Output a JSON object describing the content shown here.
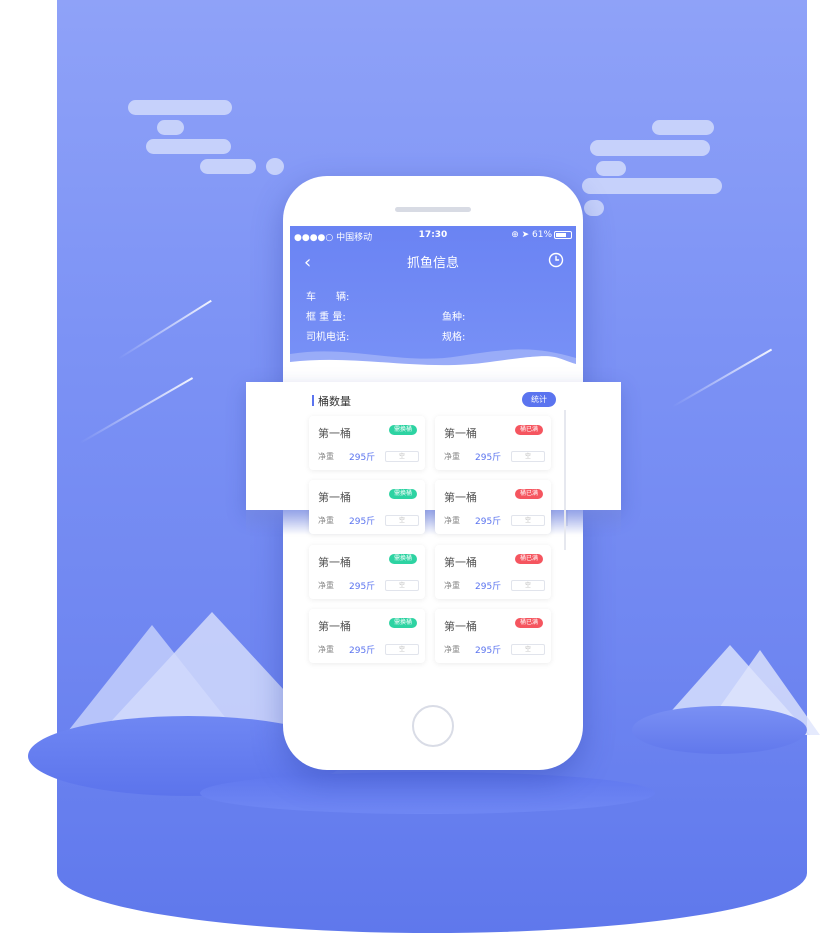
{
  "status_bar": {
    "carrier": "●●●●○ 中国移动",
    "time": "17:30",
    "battery": "⊕ ➤ 61%"
  },
  "nav": {
    "back_icon": "chevron-left-icon",
    "title": "抓鱼信息",
    "clock_icon": "clock-icon"
  },
  "info": {
    "vehicle_label": "车　　辆:",
    "frame_weight_label": "框 重 量:",
    "fish_type_label": "鱼种:",
    "driver_phone_label": "司机电话:",
    "spec_label": "规格:"
  },
  "section": {
    "title": "桶数量",
    "stat_button": "统计"
  },
  "buckets": [
    {
      "title": "第一桶",
      "badge": "需换桶",
      "badge_color": "#2dd3a2",
      "weight_label": "净重",
      "weight": "295斤",
      "input": "空"
    },
    {
      "title": "第一桶",
      "badge": "桶已满",
      "badge_color": "#f5555f",
      "weight_label": "净重",
      "weight": "295斤",
      "input": "空"
    },
    {
      "title": "第一桶",
      "badge": "需换桶",
      "badge_color": "#2dd3a2",
      "weight_label": "净重",
      "weight": "295斤",
      "input": "空"
    },
    {
      "title": "第一桶",
      "badge": "桶已满",
      "badge_color": "#f5555f",
      "weight_label": "净重",
      "weight": "295斤",
      "input": "空"
    },
    {
      "title": "第一桶",
      "badge": "需换桶",
      "badge_color": "#2dd3a2",
      "weight_label": "净重",
      "weight": "295斤",
      "input": "空"
    },
    {
      "title": "第一桶",
      "badge": "桶已满",
      "badge_color": "#f5555f",
      "weight_label": "净重",
      "weight": "295斤",
      "input": "空"
    },
    {
      "title": "第一桶",
      "badge": "需换桶",
      "badge_color": "#2dd3a2",
      "weight_label": "净重",
      "weight": "295斤",
      "input": "空"
    },
    {
      "title": "第一桶",
      "badge": "桶已满",
      "badge_color": "#f5555f",
      "weight_label": "净重",
      "weight": "295斤",
      "input": "空"
    }
  ],
  "colors": {
    "accent": "#5b74ef",
    "green_badge": "#2dd3a2",
    "red_badge": "#f5555f"
  }
}
